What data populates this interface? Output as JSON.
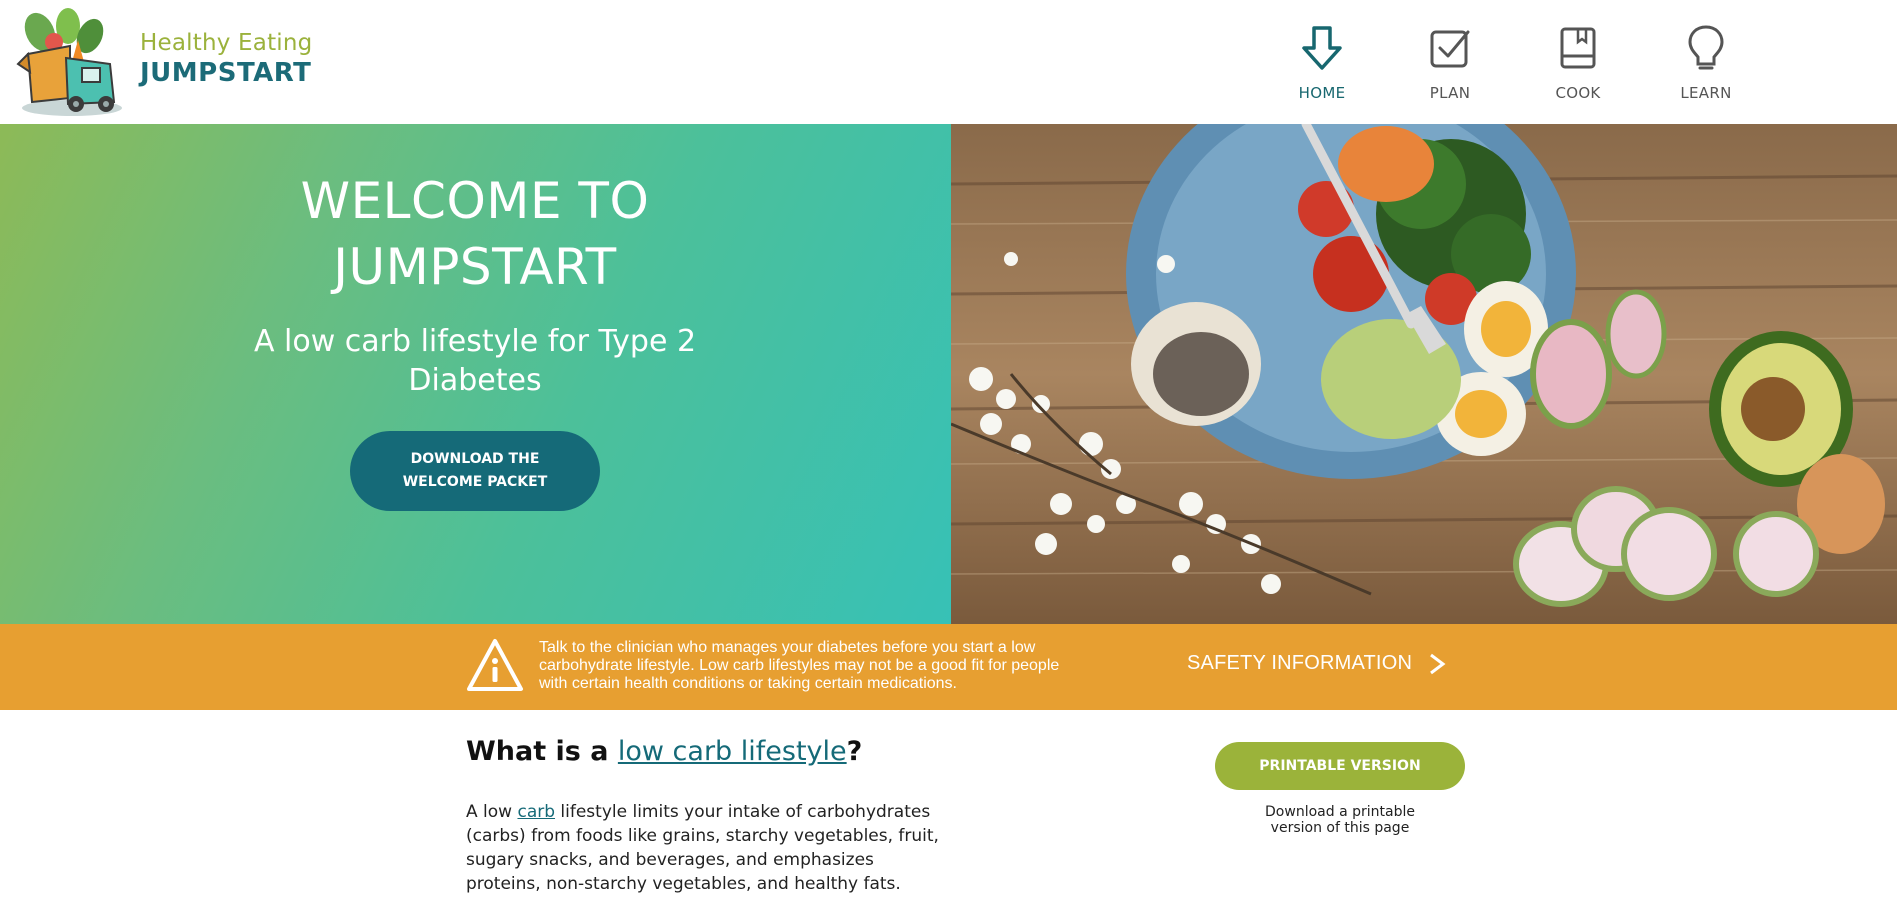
{
  "brand": {
    "line1": "Healthy Eating",
    "line2": "JUMPSTART"
  },
  "nav": {
    "items": [
      {
        "label": "HOME",
        "icon": "arrow-down-icon",
        "active": true
      },
      {
        "label": "PLAN",
        "icon": "checkbox-icon",
        "active": false
      },
      {
        "label": "COOK",
        "icon": "cookbook-icon",
        "active": false
      },
      {
        "label": "LEARN",
        "icon": "lightbulb-icon",
        "active": false
      }
    ]
  },
  "hero": {
    "title": "WELCOME TO JUMPSTART",
    "subtitle": "A low carb lifestyle for Type 2 Diabetes",
    "button_label": "DOWNLOAD THE WELCOME PACKET",
    "image": "food-plate-photo"
  },
  "safety": {
    "icon": "warning-icon",
    "text": "Talk to the clinician who manages your diabetes before you start a low carbohydrate lifestyle. Low carb lifestyles may not be a good fit for people with certain health conditions or taking certain medications.",
    "link_label": "SAFETY INFORMATION",
    "link_icon": "chevron-right-icon"
  },
  "content": {
    "heading_prefix": "What is a ",
    "heading_link": "low carb lifestyle",
    "heading_suffix": "?",
    "body_prefix": "A low ",
    "body_link": "carb",
    "body_suffix": " lifestyle limits your intake of carbohydrates (carbs) from foods like grains, starchy vegetables, fruit, sugary snacks, and beverages, and emphasizes proteins, non-starchy vegetables, and healthy fats."
  },
  "print": {
    "button_label": "PRINTABLE VERSION",
    "note": "Download a printable version of this page"
  },
  "colors": {
    "brand_green": "#9bb23c",
    "brand_teal": "#1c6b78",
    "banner_orange": "#e79f31",
    "button_teal": "#156a78"
  }
}
